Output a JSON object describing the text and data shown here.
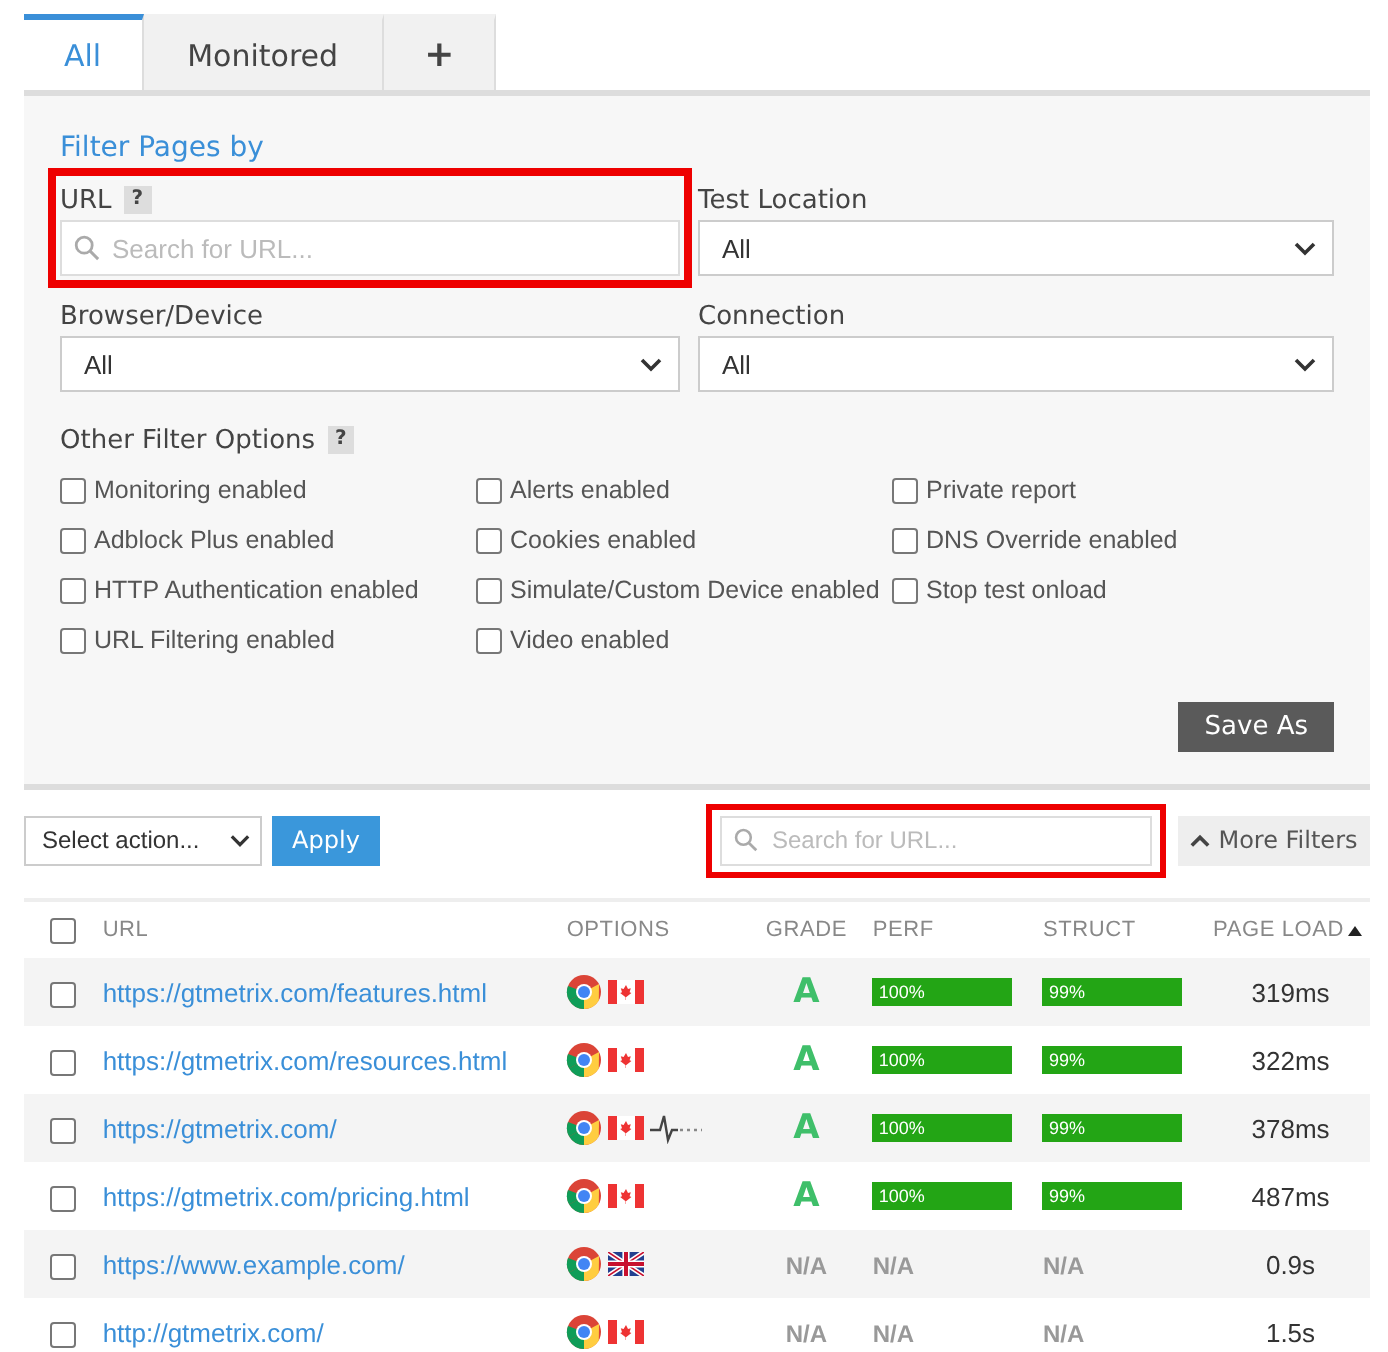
{
  "tabs": [
    {
      "label": "All",
      "selected": true
    },
    {
      "label": "Monitored",
      "selected": false
    },
    {
      "label": "+",
      "selected": false
    }
  ],
  "filter_panel": {
    "title": "Filter Pages by",
    "url_field": {
      "label": "URL",
      "help": "?",
      "placeholder": "Search for URL...",
      "highlighted": true
    },
    "test_location": {
      "label": "Test Location",
      "value": "All"
    },
    "browser_device": {
      "label": "Browser/Device",
      "value": "All"
    },
    "connection": {
      "label": "Connection",
      "value": "All"
    },
    "other_options": {
      "label": "Other Filter Options",
      "help": "?",
      "items": [
        {
          "label": "Monitoring enabled",
          "checked": false
        },
        {
          "label": "Alerts enabled",
          "checked": false
        },
        {
          "label": "Private report",
          "checked": false
        },
        {
          "label": "Adblock Plus enabled",
          "checked": false
        },
        {
          "label": "Cookies enabled",
          "checked": false
        },
        {
          "label": "DNS Override enabled",
          "checked": false
        },
        {
          "label": "HTTP Authentication enabled",
          "checked": false
        },
        {
          "label": "Simulate/Custom Device enabled",
          "checked": false
        },
        {
          "label": "Stop test onload",
          "checked": false
        },
        {
          "label": "URL Filtering enabled",
          "checked": false
        },
        {
          "label": "Video enabled",
          "checked": false
        }
      ]
    },
    "save_button": "Save As"
  },
  "toolbar": {
    "action_select": "Select action...",
    "apply_button": "Apply",
    "search": {
      "placeholder": "Search for URL...",
      "highlighted": true
    },
    "more_filters": "More Filters"
  },
  "table": {
    "select_all_checked": false,
    "columns": [
      {
        "label": "URL",
        "sorted": false
      },
      {
        "label": "OPTIONS",
        "sorted": false
      },
      {
        "label": "GRADE",
        "sorted": false
      },
      {
        "label": "PERF",
        "sorted": false
      },
      {
        "label": "STRUCT",
        "sorted": false
      },
      {
        "label": "PAGE LOAD",
        "sorted": true
      }
    ],
    "rows": [
      {
        "checked": false,
        "url": "https://gtmetrix.com/features.html",
        "flag": {
          "kind": "ca"
        },
        "monitored": false,
        "grade": "A",
        "perf": {
          "text": "100%",
          "kind": "bar"
        },
        "struct": {
          "text": "99%",
          "kind": "bar"
        },
        "page_load": "319ms"
      },
      {
        "checked": false,
        "url": "https://gtmetrix.com/resources.html",
        "flag": {
          "kind": "ca"
        },
        "monitored": false,
        "grade": "A",
        "perf": {
          "text": "100%",
          "kind": "bar"
        },
        "struct": {
          "text": "99%",
          "kind": "bar"
        },
        "page_load": "322ms"
      },
      {
        "checked": false,
        "url": "https://gtmetrix.com/",
        "flag": {
          "kind": "ca"
        },
        "monitored": true,
        "grade": "A",
        "perf": {
          "text": "100%",
          "kind": "bar"
        },
        "struct": {
          "text": "99%",
          "kind": "bar"
        },
        "page_load": "378ms"
      },
      {
        "checked": false,
        "url": "https://gtmetrix.com/pricing.html",
        "flag": {
          "kind": "ca"
        },
        "monitored": false,
        "grade": "A",
        "perf": {
          "text": "100%",
          "kind": "bar"
        },
        "struct": {
          "text": "99%",
          "kind": "bar"
        },
        "page_load": "487ms"
      },
      {
        "checked": false,
        "url": "https://www.example.com/",
        "flag": {
          "kind": "gb"
        },
        "monitored": false,
        "grade": "N/A",
        "perf": {
          "text": "N/A",
          "kind": "text"
        },
        "struct": {
          "text": "N/A",
          "kind": "text"
        },
        "page_load": "0.9s"
      },
      {
        "checked": false,
        "url": "http://gtmetrix.com/",
        "flag": {
          "kind": "ca"
        },
        "monitored": false,
        "grade": "N/A",
        "perf": {
          "text": "N/A",
          "kind": "text"
        },
        "struct": {
          "text": "N/A",
          "kind": "text"
        },
        "page_load": "1.5s"
      }
    ]
  }
}
